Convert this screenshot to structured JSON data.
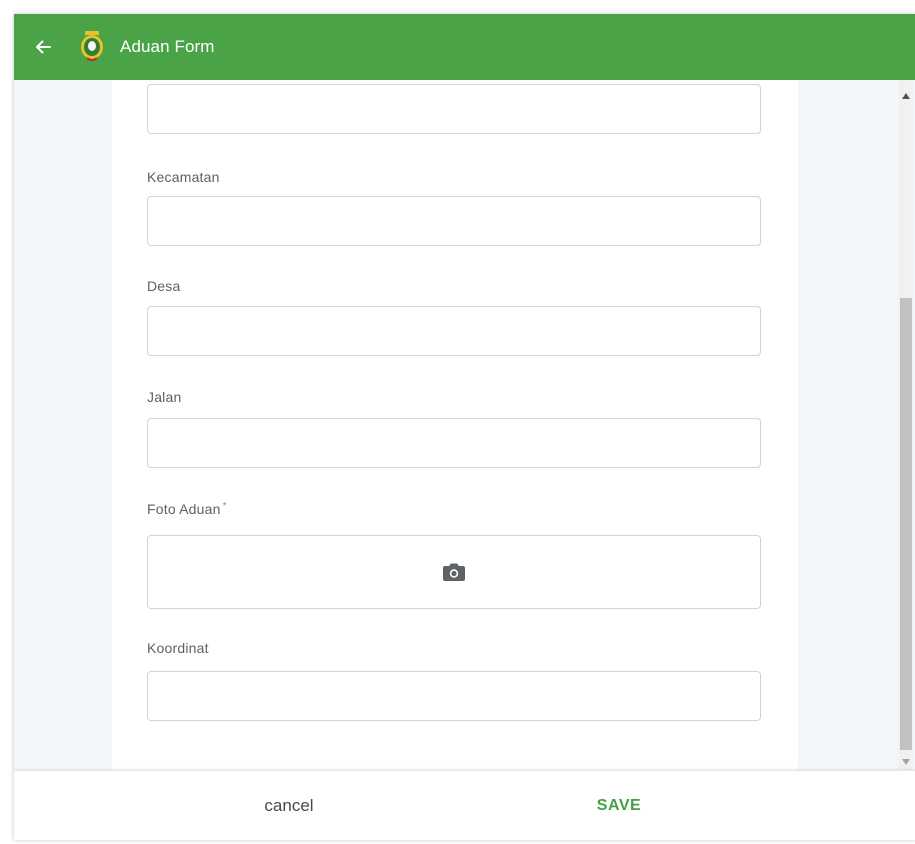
{
  "header": {
    "title": "Aduan Form",
    "back_icon": "arrow-left-icon",
    "logo_icon": "regional-emblem-icon"
  },
  "form": {
    "fields": [
      {
        "label": "",
        "value": ""
      },
      {
        "label": "Kecamatan",
        "value": ""
      },
      {
        "label": "Desa",
        "value": ""
      },
      {
        "label": "Jalan",
        "value": ""
      },
      {
        "label": "Foto Aduan",
        "required_mark": "*",
        "value": "",
        "icon": "camera-icon"
      },
      {
        "label": "Koordinat",
        "value": ""
      }
    ]
  },
  "footer": {
    "cancel_label": "cancel",
    "save_label": "SAVE"
  },
  "colors": {
    "appbar": "#4aa447",
    "save_text": "#43a047",
    "background": "#f4f7fa"
  }
}
